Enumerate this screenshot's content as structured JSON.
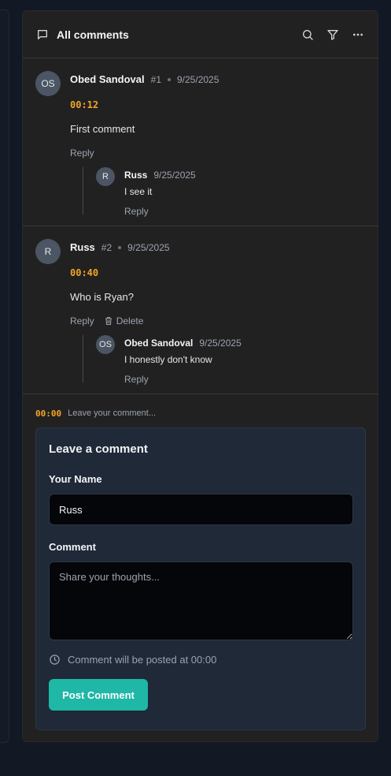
{
  "header": {
    "title": "All comments",
    "icons": [
      "comment-icon",
      "search-icon",
      "filter-icon",
      "more-icon"
    ]
  },
  "threads": [
    {
      "initials": "OS",
      "author": "Obed Sandoval",
      "number": "#1",
      "date": "9/25/2025",
      "timestamp": "00:12",
      "text": "First comment",
      "reply_label": "Reply",
      "replies": [
        {
          "initials": "R",
          "author": "Russ",
          "date": "9/25/2025",
          "text": "I see it",
          "reply_label": "Reply"
        }
      ]
    },
    {
      "initials": "R",
      "author": "Russ",
      "number": "#2",
      "date": "9/25/2025",
      "timestamp": "00:40",
      "text": "Who is Ryan?",
      "reply_label": "Reply",
      "delete_label": "Delete",
      "replies": [
        {
          "initials": "OS",
          "author": "Obed Sandoval",
          "date": "9/25/2025",
          "text": "I honestly don't know",
          "reply_label": "Reply"
        }
      ]
    }
  ],
  "composer": {
    "timestamp": "00:00",
    "prompt": "Leave your comment..."
  },
  "form": {
    "title": "Leave a comment",
    "name_label": "Your Name",
    "name_value": "Russ",
    "comment_label": "Comment",
    "comment_placeholder": "Share your thoughts...",
    "hint": "Comment will be posted at 00:00",
    "submit_label": "Post Comment"
  },
  "colors": {
    "timestamp": "#f5a524",
    "button": "#1fb7a6",
    "panel": "#212121",
    "card": "#1f2937"
  }
}
